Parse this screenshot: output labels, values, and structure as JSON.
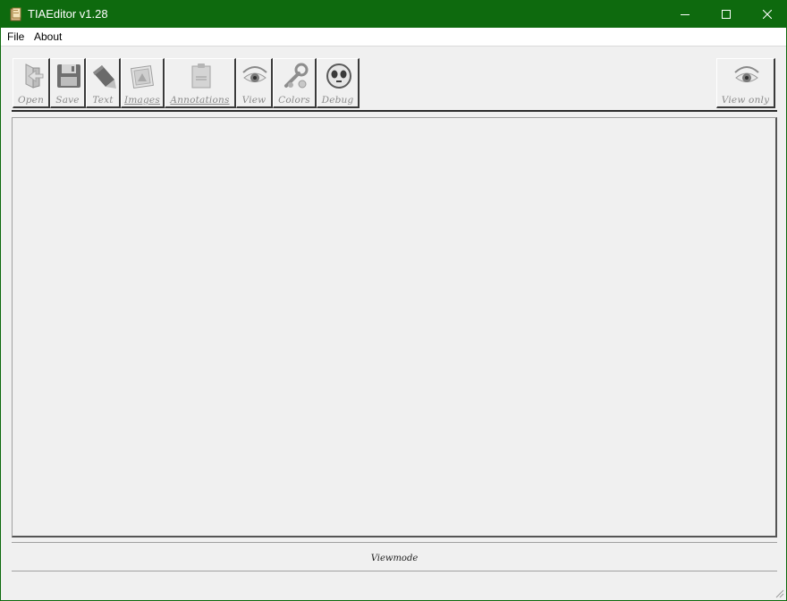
{
  "window": {
    "title": "TIAEditor v1.28",
    "titlebar_color": "#0e6a0e",
    "controls": [
      "minimize-icon",
      "maximize-icon",
      "close-icon"
    ]
  },
  "menu": {
    "file": "File",
    "about": "About"
  },
  "toolbar": {
    "open": "Open",
    "save": "Save",
    "text": "Text",
    "images": "Images",
    "annotations": "Annotations",
    "view": "View",
    "colors": "Colors",
    "debug": "Debug",
    "view_only": "View only"
  },
  "status": {
    "mode": "Viewmode"
  }
}
